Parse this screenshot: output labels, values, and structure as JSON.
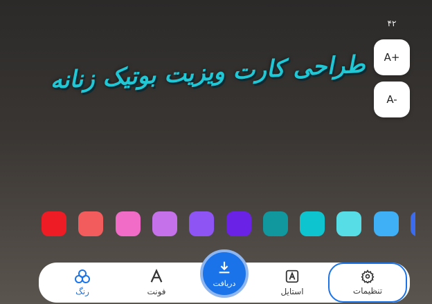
{
  "font_size_readout": "۴۲",
  "size_controls": {
    "increase_label": "A+",
    "decrease_label": "A-"
  },
  "headline_text": "طراحی کارت ویزیت بوتیک زنانه",
  "headline_color": "#22c7d6",
  "swatches": [
    "#ee1c24",
    "#f25c5c",
    "#f06cc6",
    "#c471ea",
    "#8e55f4",
    "#6a22e6",
    "#11979e",
    "#0ec4cf",
    "#56dde6",
    "#3fb0f5",
    "#3b6cf0"
  ],
  "bottom_nav": {
    "settings_label": "تنظیمات",
    "style_label": "استایل",
    "download_label": "دریافت",
    "font_label": "فونت",
    "color_label": "رنگ",
    "active_color": "#1a73e8"
  }
}
